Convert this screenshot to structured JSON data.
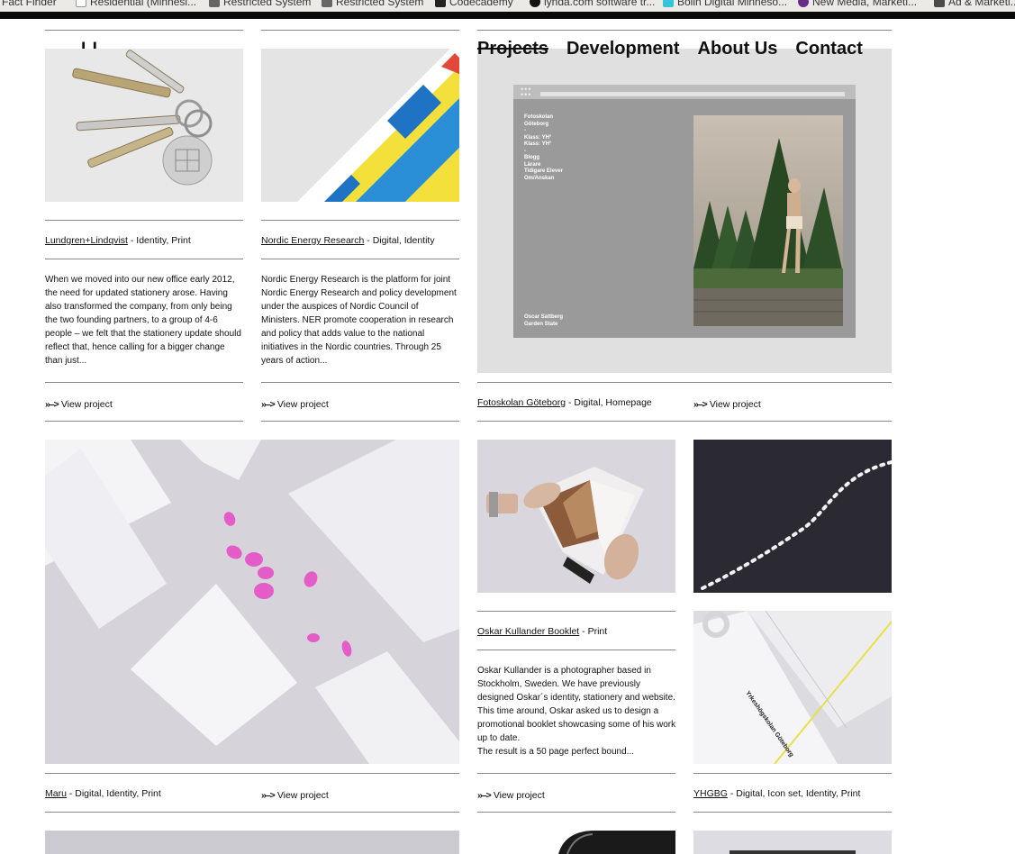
{
  "bookmarks": [
    {
      "label": "Fact Finder",
      "icon": "bookmark-icon",
      "color": "#777777"
    },
    {
      "label": "Residential (Minnesi...",
      "icon": "page-icon",
      "color": "#ffffff"
    },
    {
      "label": "Restricted System",
      "icon": "pen-icon",
      "color": "#555555"
    },
    {
      "label": "Restricted System",
      "icon": "pen-icon",
      "color": "#555555"
    },
    {
      "label": "Codecademy",
      "icon": "codecademy-icon",
      "color": "#222222"
    },
    {
      "label": "lynda.com software tr...",
      "icon": "lynda-icon",
      "color": "#111111"
    },
    {
      "label": "Bolin Digital Minneso...",
      "icon": "bolin-icon",
      "color": "#35c4d8"
    },
    {
      "label": "New Media, Marketi...",
      "icon": "circle-icon",
      "color": "#6a2c8a"
    },
    {
      "label": "Ad & Marketi...",
      "icon": "ad-icon",
      "color": "#4a4a4a"
    }
  ],
  "site": {
    "logo": "LL",
    "nav": [
      "Projects",
      "Development",
      "About Us",
      "Contact"
    ]
  },
  "projects": {
    "lindqvist": {
      "name": "Lundgren+Lindqvist",
      "tags": " - Identity, Print",
      "desc": "When we moved into our new office early 2012, the need for updated stationery arose. Having also transformed the company, from only being the two founding partners, to a group of 4-6 people – we felt that the stationery update should reflect that, hence calling for a bigger change than just...",
      "view": "View project"
    },
    "ner": {
      "name": "Nordic Energy Research",
      "tags": " - Digital, Identity",
      "desc": "Nordic Energy Research is the platform for joint Nordic Energy Research and policy development under the auspices of Nordic Council of Ministers. NER promote cooperation in research and policy that adds value to the national initiatives in the Nordic countries. Through 25 years of action...",
      "view": "View project"
    },
    "fotoskolan": {
      "name": "Fotoskolan Göteborg",
      "tags": " - Digital, Homepage",
      "view": "View project",
      "mock_menu": [
        "Fotoskolan",
        "Göteborg",
        "-",
        "Klass: YH°",
        "Klass: YH°",
        "-",
        "Blogg",
        "Lärare",
        "Tidigare Elever",
        "Om/Anskan"
      ],
      "mock_footer": [
        "Oscar Sattberg",
        "Garden State"
      ]
    },
    "maru": {
      "name": "Maru",
      "tags": " - Digital, Identity, Print",
      "view": "View project"
    },
    "kullander": {
      "name": "Oskar Kullander Booklet",
      "tags": " - Print",
      "desc": "Oskar Kullander is a photographer based in Stockholm, Sweden. We have previously designed Oskar´s identity, stationery and website. This time around, Oskar asked us to design a promotional booklet showcasing some of his work up to date.\nThe result is a 50 page perfect bound...",
      "view": "View project"
    },
    "yhgbg": {
      "name": "YHGBG",
      "tags": " - Digital, Icon set, Identity, Print",
      "card_text": "Yrkeshögskolan Göteborg"
    }
  },
  "view_arrow": "»–>",
  "colors": {
    "ner_blue": "#1f73c4",
    "ner_lightblue": "#2a8fd6",
    "ner_yellow": "#f4e03a",
    "ner_red": "#e0483a",
    "maru_pink": "#e45cc8",
    "yhgbg_yellow": "#e8e04a"
  }
}
